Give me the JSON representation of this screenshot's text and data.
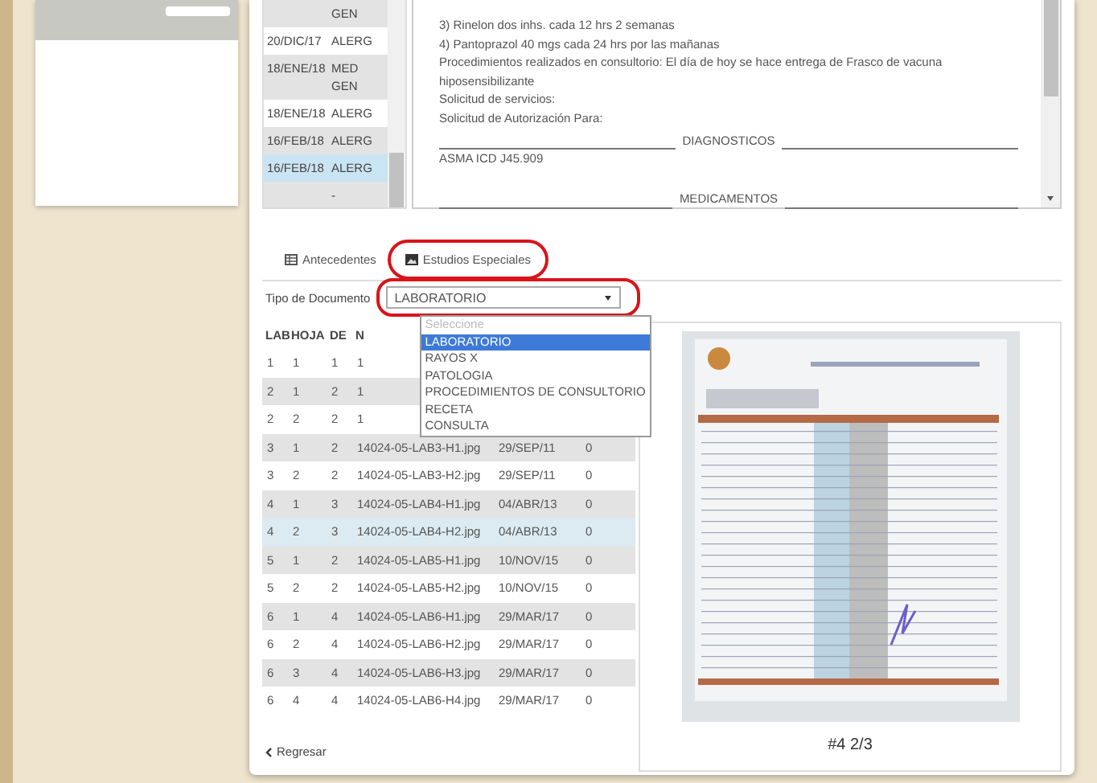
{
  "visits": [
    {
      "specialty": "GEN",
      "selected": false
    },
    {
      "date": "20/DIC/17",
      "specialty": "ALERG",
      "selected": false
    },
    {
      "date": "18/ENE/18",
      "specialty": "MED GEN",
      "selected": false
    },
    {
      "date": "18/ENE/18",
      "specialty": "ALERG",
      "selected": false
    },
    {
      "date": "16/FEB/18",
      "specialty": "ALERG",
      "selected": false
    },
    {
      "date": "16/FEB/18",
      "specialty": "ALERG",
      "selected": true
    },
    {
      "specialty": "-",
      "selected": false
    }
  ],
  "notes": [
    {
      "kind": "text",
      "text": "3) Rinelon dos inhs. cada 12 hrs 2 semanas"
    },
    {
      "kind": "text",
      "text": "4) Pantoprazol 40 mgs cada 24 hrs por las mañanas"
    },
    {
      "kind": "text",
      "text": "Procedimientos realizados en consultorio: El día de hoy se hace entrega de Frasco de vacuna hiposensibilizante"
    },
    {
      "kind": "text",
      "text": "Solicitud de servicios:"
    },
    {
      "kind": "text",
      "text": "Solicitud de Autorización Para:"
    },
    {
      "kind": "heading",
      "text": "DIAGNOSTICOS"
    },
    {
      "kind": "text",
      "text": "ASMA ICD J45.909"
    },
    {
      "kind": "blank"
    },
    {
      "kind": "heading",
      "text": "MEDICAMENTOS"
    }
  ],
  "tabs": [
    {
      "label": "Antecedentes",
      "annotated": false
    },
    {
      "label": "Estudios Especiales",
      "annotated": true
    }
  ],
  "document_type": {
    "label": "Tipo de Documento",
    "value": "LABORATORIO",
    "annotated": true,
    "options": [
      {
        "label": "Seleccione",
        "disabled": true,
        "selected": false
      },
      {
        "label": "LABORATORIO",
        "disabled": false,
        "selected": true
      },
      {
        "label": "RAYOS X",
        "disabled": false,
        "selected": false
      },
      {
        "label": "PATOLOGIA",
        "disabled": false,
        "selected": false
      },
      {
        "label": "PROCEDIMIENTOS DE CONSULTORIO",
        "disabled": false,
        "selected": false
      },
      {
        "label": "RECETA",
        "disabled": false,
        "selected": false
      },
      {
        "label": "CONSULTA",
        "disabled": false,
        "selected": false
      }
    ]
  },
  "table": {
    "columns": [
      "LAB",
      "HOJA",
      "DE",
      "N"
    ],
    "rows": [
      {
        "cells": [
          "1",
          "1",
          "1",
          "1"
        ],
        "selected": false
      },
      {
        "cells": [
          "2",
          "1",
          "2",
          "1"
        ],
        "selected": false
      },
      {
        "cells": [
          "2",
          "2",
          "2",
          "1"
        ],
        "selected": false
      },
      {
        "cells": [
          "3",
          "1",
          "2",
          "14024-05-LAB3-H1.jpg",
          "29/SEP/11",
          "0"
        ],
        "selected": false
      },
      {
        "cells": [
          "3",
          "2",
          "2",
          "14024-05-LAB3-H2.jpg",
          "29/SEP/11",
          "0"
        ],
        "selected": false
      },
      {
        "cells": [
          "4",
          "1",
          "3",
          "14024-05-LAB4-H1.jpg",
          "04/ABR/13",
          "0"
        ],
        "selected": false
      },
      {
        "cells": [
          "4",
          "2",
          "3",
          "14024-05-LAB4-H2.jpg",
          "04/ABR/13",
          "0"
        ],
        "selected": true
      },
      {
        "cells": [
          "5",
          "1",
          "2",
          "14024-05-LAB5-H1.jpg",
          "10/NOV/15",
          "0"
        ],
        "selected": false
      },
      {
        "cells": [
          "5",
          "2",
          "2",
          "14024-05-LAB5-H2.jpg",
          "10/NOV/15",
          "0"
        ],
        "selected": false
      },
      {
        "cells": [
          "6",
          "1",
          "4",
          "14024-05-LAB6-H1.jpg",
          "29/MAR/17",
          "0"
        ],
        "selected": false
      },
      {
        "cells": [
          "6",
          "2",
          "4",
          "14024-05-LAB6-H2.jpg",
          "29/MAR/17",
          "0"
        ],
        "selected": false
      },
      {
        "cells": [
          "6",
          "3",
          "4",
          "14024-05-LAB6-H3.jpg",
          "29/MAR/17",
          "0"
        ],
        "selected": false
      },
      {
        "cells": [
          "6",
          "4",
          "4",
          "14024-05-LAB6-H4.jpg",
          "29/MAR/17",
          "0"
        ],
        "selected": false
      }
    ]
  },
  "back_link": "Regresar",
  "viewer": {
    "caption": "#4 2/3"
  }
}
